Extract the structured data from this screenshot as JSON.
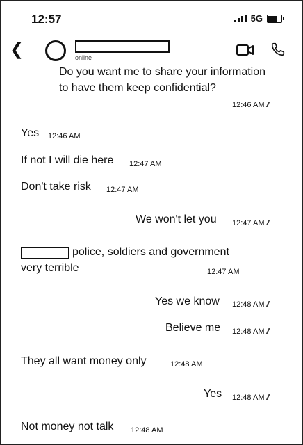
{
  "status_bar": {
    "time": "12:57",
    "network": "5G"
  },
  "chat_header": {
    "status": "online"
  },
  "messages": [
    {
      "side": "sent",
      "lines": [
        "Do you want me to share your information",
        "to have them keep confidential?"
      ],
      "time": "12:46 AM"
    },
    {
      "side": "received",
      "text": "Yes",
      "time": "12:46 AM"
    },
    {
      "side": "received",
      "text": "If not I will die here",
      "time": "12:47 AM"
    },
    {
      "side": "received",
      "text": "Don't take risk",
      "time": "12:47 AM"
    },
    {
      "side": "sent",
      "text": "We won't let you",
      "time": "12:47 AM"
    },
    {
      "side": "received",
      "lines": [
        "police, soldiers and government",
        "very terrible"
      ],
      "time": "12:47 AM"
    },
    {
      "side": "sent",
      "text": "Yes we know",
      "time": "12:48 AM"
    },
    {
      "side": "sent",
      "text": "Believe me",
      "time": "12:48 AM"
    },
    {
      "side": "received",
      "text": "They all want money only",
      "time": "12:48 AM"
    },
    {
      "side": "sent",
      "text": "Yes",
      "time": "12:48 AM"
    },
    {
      "side": "received",
      "text": "Not money not talk",
      "time": "12:48 AM"
    }
  ]
}
